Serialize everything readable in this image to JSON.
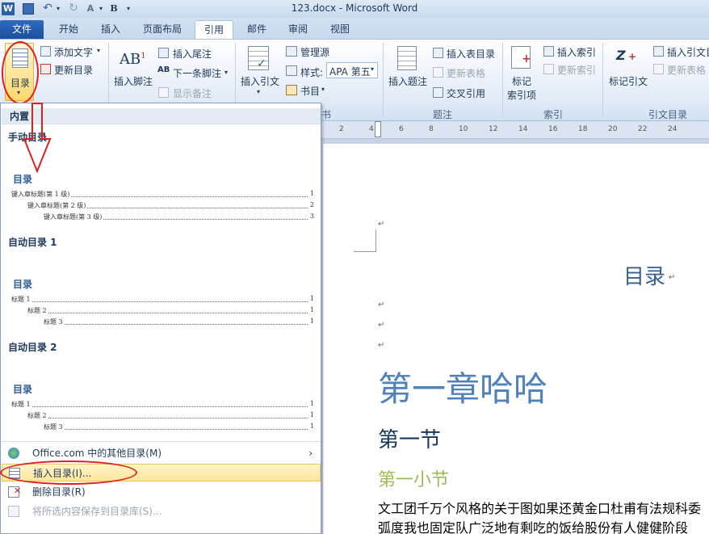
{
  "window": {
    "title": "123.docx  -  Microsoft Word",
    "quick_access": [
      "save-icon",
      "undo-icon",
      "redo-icon",
      "format-painter-icon",
      "bold-icon"
    ],
    "bold_label": "B"
  },
  "tabs": [
    {
      "label": "文件"
    },
    {
      "label": "开始"
    },
    {
      "label": "插入"
    },
    {
      "label": "页面布局"
    },
    {
      "label": "引用"
    },
    {
      "label": "邮件"
    },
    {
      "label": "审阅"
    },
    {
      "label": "视图"
    }
  ],
  "ribbon": {
    "toc": {
      "label": "目录",
      "add_text": "添加文字",
      "update_toc": "更新目录"
    },
    "footnotes": {
      "insert_footnote": "插入脚注",
      "insert_endnote": "插入尾注",
      "next_footnote": "下一条脚注",
      "show_notes": "显示备注"
    },
    "citations": {
      "insert_citation": "插入引文",
      "manage_sources": "管理源",
      "style_label": "样式:",
      "style_value": "APA 第五",
      "bibliography": "书目",
      "group_label": "书目"
    },
    "captions": {
      "insert_caption": "插入题注",
      "insert_table_of_figures": "插入表目录",
      "update_table": "更新表格",
      "cross_reference": "交叉引用",
      "group_label": "题注"
    },
    "index": {
      "mark_entry": "标记\n索引项",
      "mark_entry_line1": "标记",
      "mark_entry_line2": "索引项",
      "insert_index": "插入索引",
      "update_index": "更新索引",
      "group_label": "索引"
    },
    "toa": {
      "mark_citation": "标记引文",
      "insert_toa": "插入引文目",
      "update_table": "更新表格",
      "group_label": "引文目录"
    },
    "ab_glyph": "AB",
    "ab_sup": "1"
  },
  "ruler": {
    "ticks": [
      "2",
      "4",
      "6",
      "8",
      "10",
      "12",
      "14",
      "16",
      "18",
      "20",
      "22",
      "24"
    ]
  },
  "dropdown": {
    "section_builtin": "内置",
    "gallery": [
      {
        "name": "手动目录",
        "toc_title": "目录",
        "lines": [
          {
            "text": "键入章标题(第 1 级)",
            "page": "1"
          },
          {
            "text": "键入章标题(第 2 级)",
            "page": "2"
          },
          {
            "text": "键入章标题(第 3 级)",
            "page": "3"
          }
        ]
      },
      {
        "name": "自动目录 1",
        "toc_title": "目录",
        "lines": [
          {
            "text": "标题 1",
            "page": "1"
          },
          {
            "text": "标题 2",
            "page": "1"
          },
          {
            "text": "标题 3",
            "page": "1"
          }
        ]
      },
      {
        "name": "自动目录 2",
        "toc_title": "目录",
        "lines": [
          {
            "text": "标题 1",
            "page": "1"
          },
          {
            "text": "标题 2",
            "page": "1"
          },
          {
            "text": "标题 3",
            "page": "1"
          }
        ]
      }
    ],
    "menu": [
      {
        "label": "Office.com 中的其他目录(M)",
        "enabled": true,
        "arrow": "›"
      },
      {
        "label": "插入目录(I)...",
        "enabled": true,
        "highlighted": true
      },
      {
        "label": "删除目录(R)",
        "enabled": true
      },
      {
        "label": "将所选内容保存到目录库(S)...",
        "enabled": false
      }
    ]
  },
  "document": {
    "paragraph_mark": "↵",
    "toc_heading": "目录",
    "chapter": "第一章哈哈",
    "section": "第一节",
    "subsection": "第一小节",
    "body_line1": "文工团千万个风格的关于图如果还黄金口杜甫有法规科委",
    "body_line2": "弧度我也固定队广泛地有剩吃的饭给股份有人健健阶段",
    "colors": {
      "chapter": "#4f81bd",
      "section": "#17365d",
      "subsection": "#9bbb59",
      "toc_heading": "#365f91"
    }
  }
}
